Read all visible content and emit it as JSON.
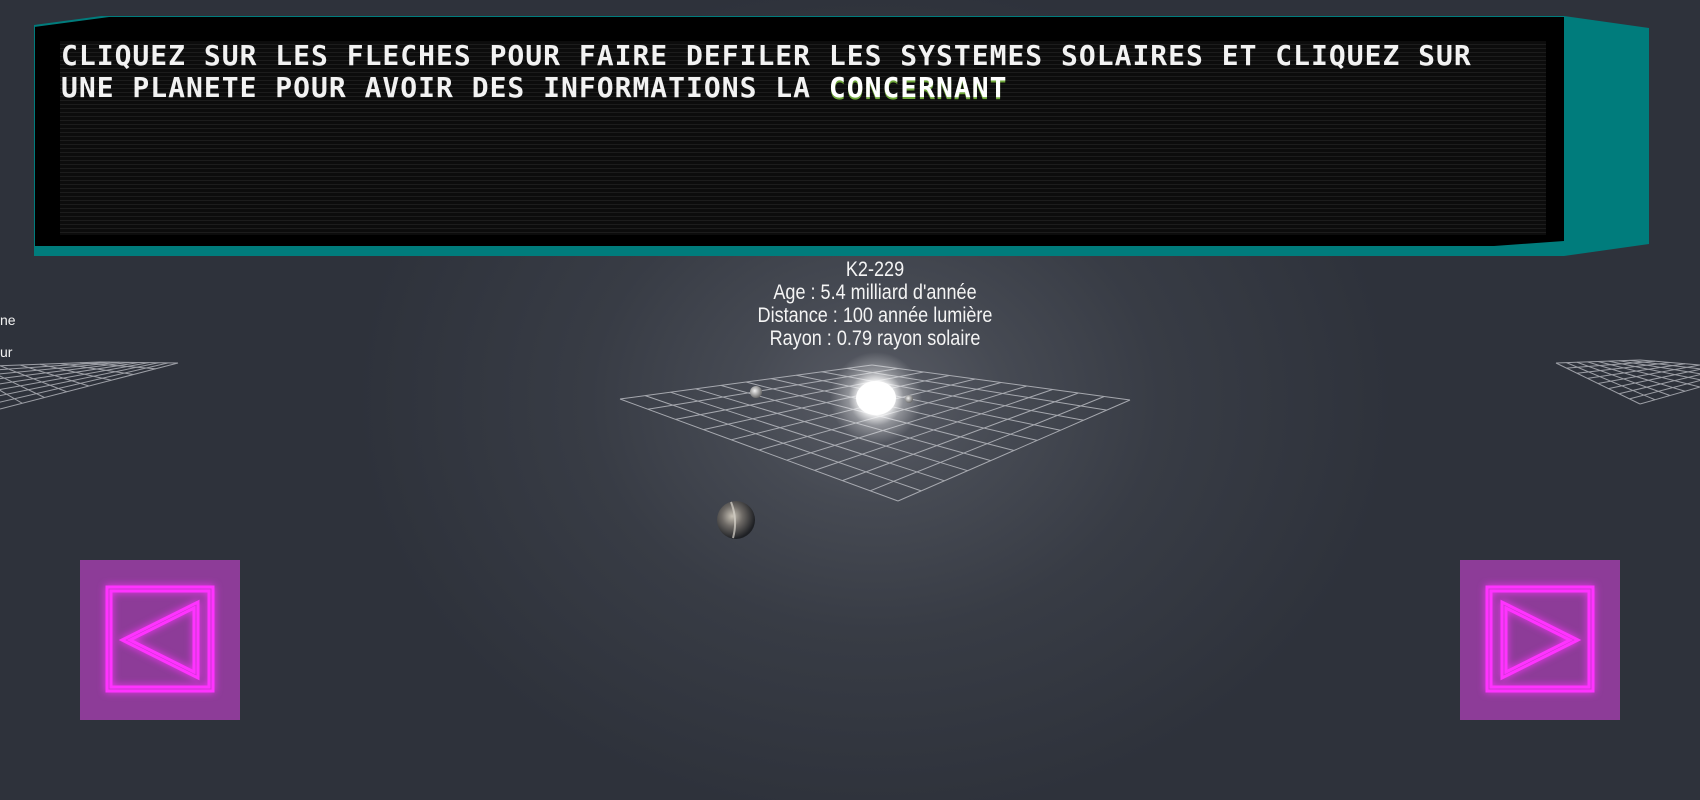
{
  "dialog": {
    "message_typed": "CLIQUEZ SUR LES FLECHES POUR FAIRE DEFILER LES SYSTEMES SOLAIRES ET CLIQUEZ SUR UNE PLANETE POUR AVOIR DES INFORMATIONS LA ",
    "message_typing": "CONCERNANT"
  },
  "star_system": {
    "name": "K2-229",
    "age": "Age : 5.4 milliard d'année",
    "distance": "Distance : 100 année lumière",
    "radius": "Rayon : 0.79 rayon solaire"
  },
  "neighbor_left": {
    "line1": "ne",
    "line2": "ur"
  },
  "navigation": {
    "prev_icon": "left-arrow-icon",
    "next_icon": "right-arrow-icon",
    "neon_color": "#ff33ff",
    "button_color": "#8d3c98"
  },
  "colors": {
    "accent_teal": "#007c7c",
    "background": "#3a3e47"
  }
}
